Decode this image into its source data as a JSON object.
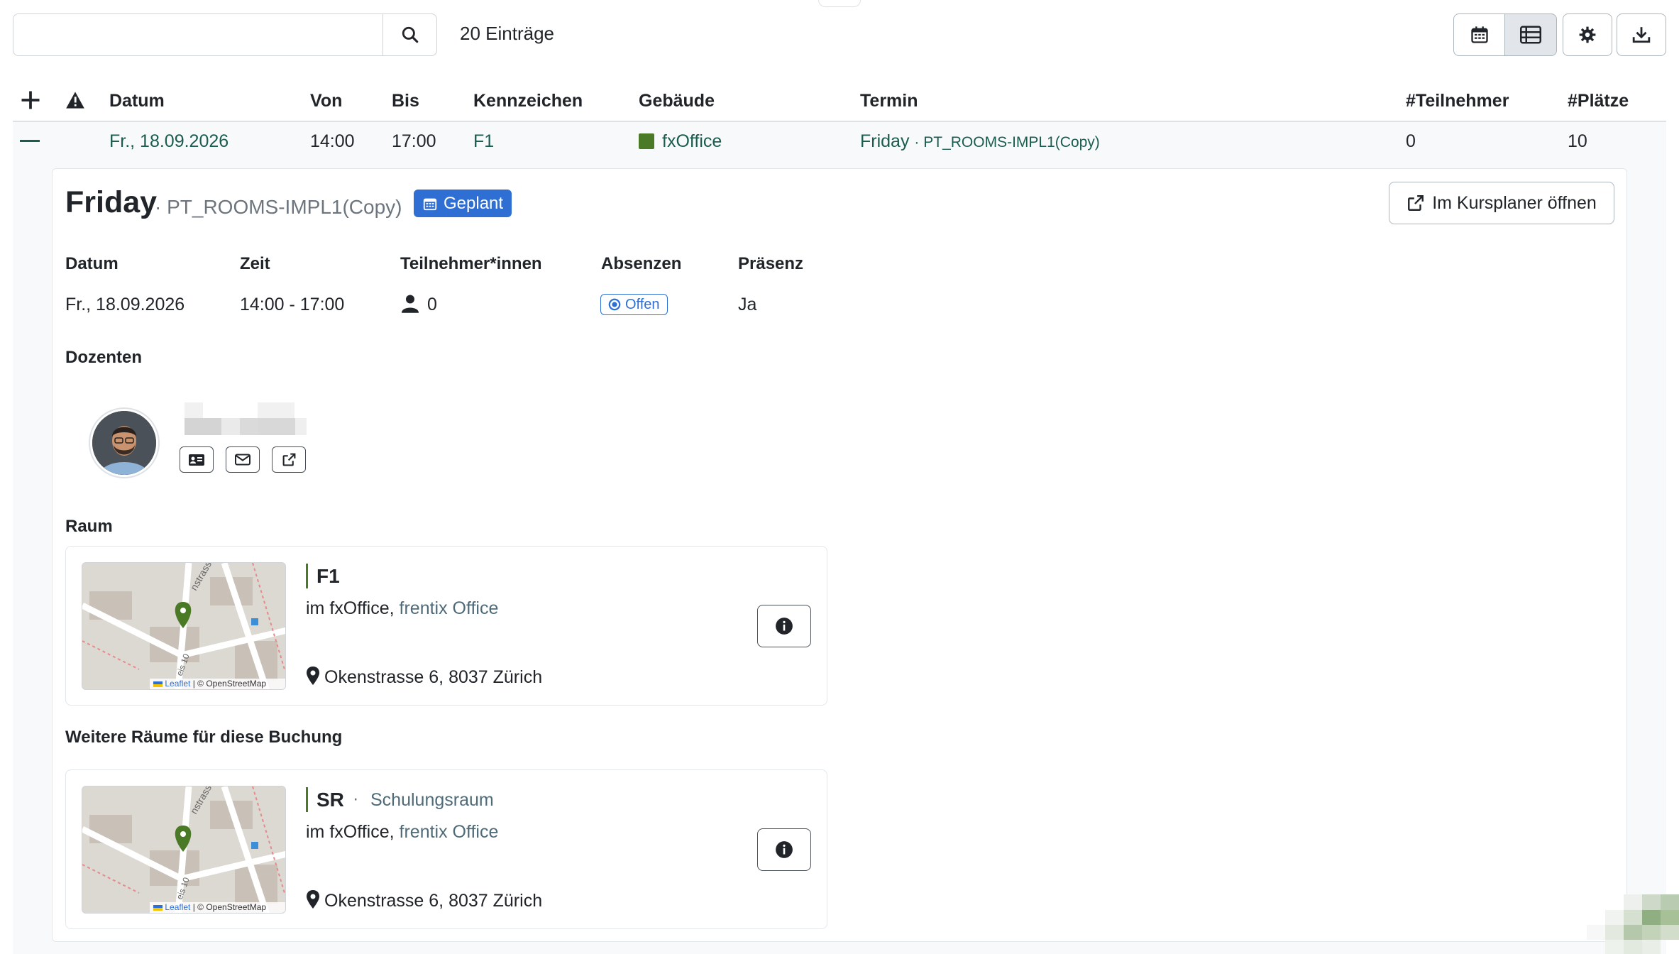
{
  "toolbar": {
    "search_placeholder": "",
    "entries_count": "20 Einträge",
    "buttons": [
      "calendar-view",
      "list-view",
      "settings",
      "download"
    ]
  },
  "table": {
    "headers": {
      "date": "Datum",
      "from": "Von",
      "to": "Bis",
      "code": "Kennzeichen",
      "building": "Gebäude",
      "event": "Termin",
      "participants": "#Teilnehmer",
      "seats": "#Plätze"
    },
    "row": {
      "date": "Fr., 18.09.2026",
      "from": "14:00",
      "to": "17:00",
      "code": "F1",
      "building": "fxOffice",
      "event_name": "Friday",
      "event_course": "PT_ROOMS-IMPL1(Copy)",
      "participants": "0",
      "seats": "10"
    }
  },
  "detail": {
    "title": "Friday",
    "subtitle": "· PT_ROOMS-IMPL1(Copy)",
    "status": "Geplant",
    "open_button": "Im Kursplaner öffnen",
    "labels": {
      "date": "Datum",
      "time": "Zeit",
      "participants": "Teilnehmer*innen",
      "absences": "Absenzen",
      "presence": "Präsenz"
    },
    "values": {
      "date": "Fr., 18.09.2026",
      "time": "14:00 - 17:00",
      "participants": "0",
      "absences": "Offen",
      "presence": "Ja"
    },
    "lecturers_label": "Dozenten",
    "room_label": "Raum",
    "room": {
      "name": "F1",
      "location_prefix": "im fxOffice,",
      "location_link": "frentix Office",
      "address": "Okenstrasse 6, 8037 Zürich",
      "map_credit_leaflet": "Leaflet",
      "map_credit_osm": "| © OpenStreetMap"
    },
    "more_rooms_label": "Weitere Räume für diese Buchung",
    "more_room": {
      "name": "SR",
      "separator": "·",
      "type": "Schulungsraum",
      "location_prefix": "im fxOffice,",
      "location_link": "frentix Office",
      "address": "Okenstrasse 6, 8037 Zürich",
      "map_credit_leaflet": "Leaflet",
      "map_credit_osm": "| © OpenStreetMap"
    }
  },
  "colors": {
    "accent_blue": "#2f6fd4",
    "link_green": "#1a5c4e",
    "building_green": "#4a7a25",
    "map_pin": "#4a7a25"
  }
}
